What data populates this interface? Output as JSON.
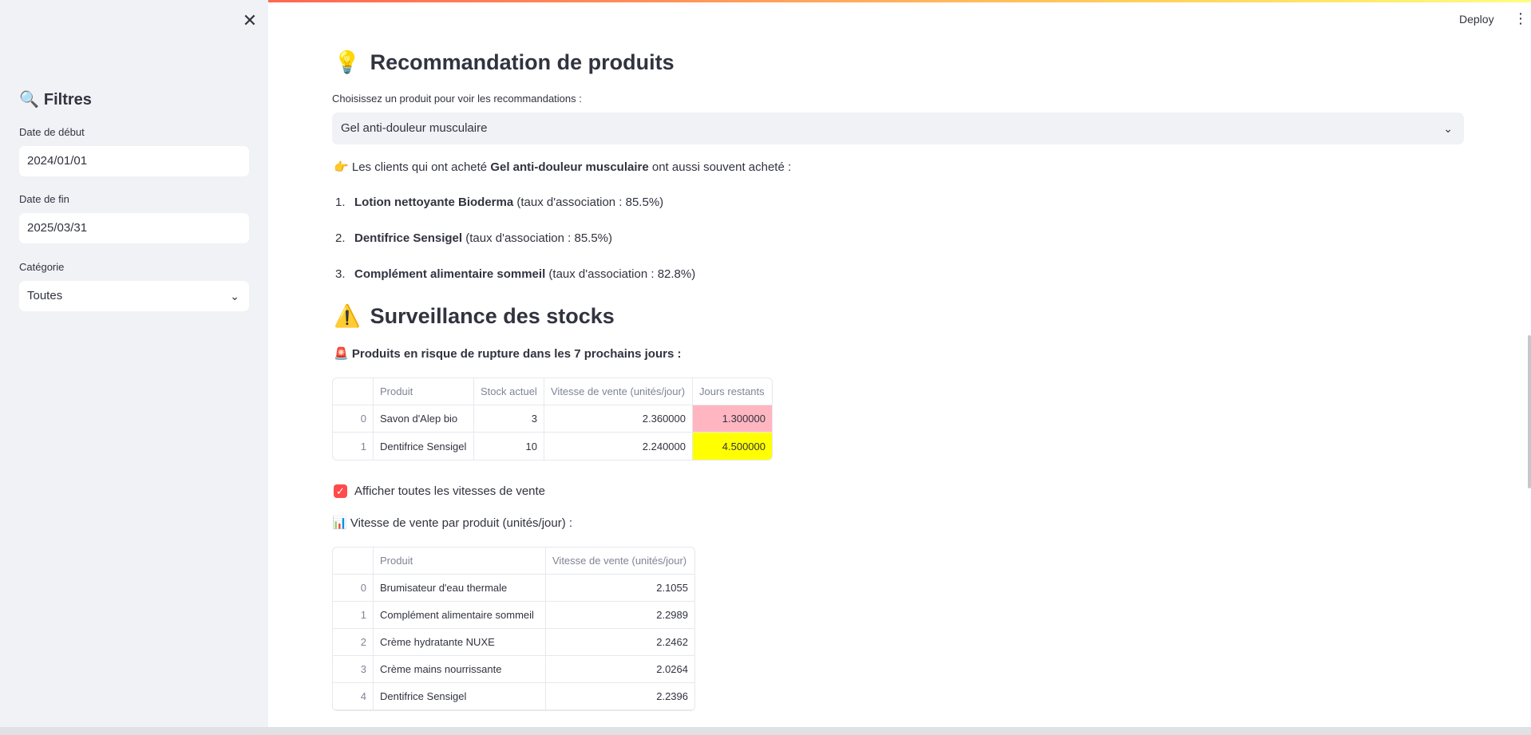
{
  "sidebar": {
    "title_icon": "🔍",
    "title": "Filtres",
    "start_date_label": "Date de début",
    "start_date_value": "2024/01/01",
    "end_date_label": "Date de fin",
    "end_date_value": "2025/03/31",
    "category_label": "Catégorie",
    "category_value": "Toutes"
  },
  "header": {
    "deploy_label": "Deploy"
  },
  "recommendation": {
    "icon": "💡",
    "title": "Recommandation de produits",
    "select_label": "Choisissez un produit pour voir les recommandations :",
    "selected_product": "Gel anti-douleur musculaire",
    "intro_icon": "👉",
    "intro_prefix": "Les clients qui ont acheté",
    "intro_product": "Gel anti-douleur musculaire",
    "intro_suffix": "ont aussi souvent acheté :",
    "items": [
      {
        "num": "1.",
        "name": "Lotion nettoyante Bioderma",
        "rate": "(taux d'association : 85.5%)"
      },
      {
        "num": "2.",
        "name": "Dentifrice Sensigel",
        "rate": "(taux d'association : 85.5%)"
      },
      {
        "num": "3.",
        "name": "Complément alimentaire sommeil",
        "rate": "(taux d'association : 82.8%)"
      }
    ]
  },
  "stock": {
    "icon": "⚠️",
    "title": "Surveillance des stocks",
    "alert_icon": "🚨",
    "alert_text": "Produits en risque de rupture dans les 7 prochains jours :",
    "headers": [
      "",
      "Produit",
      "Stock actuel",
      "Vitesse de vente (unités/jour)",
      "Jours restants"
    ],
    "rows": [
      {
        "idx": "0",
        "product": "Savon d'Alep bio",
        "stock": "3",
        "speed": "2.360000",
        "days": "1.300000",
        "color": "#ffb6c1"
      },
      {
        "idx": "1",
        "product": "Dentifrice Sensigel",
        "stock": "10",
        "speed": "2.240000",
        "days": "4.500000",
        "color": "#ffff00"
      }
    ],
    "checkbox_label": "Afficher toutes les vitesses de vente",
    "speed_icon": "📊",
    "speed_title": "Vitesse de vente par produit (unités/jour) :",
    "speed_headers": [
      "",
      "Produit",
      "Vitesse de vente (unités/jour)"
    ],
    "speed_rows": [
      {
        "idx": "0",
        "product": "Brumisateur d'eau thermale",
        "speed": "2.1055"
      },
      {
        "idx": "1",
        "product": "Complément alimentaire sommeil",
        "speed": "2.2989"
      },
      {
        "idx": "2",
        "product": "Crème hydratante NUXE",
        "speed": "2.2462"
      },
      {
        "idx": "3",
        "product": "Crème mains nourrissante",
        "speed": "2.0264"
      },
      {
        "idx": "4",
        "product": "Dentifrice Sensigel",
        "speed": "2.2396"
      }
    ]
  }
}
